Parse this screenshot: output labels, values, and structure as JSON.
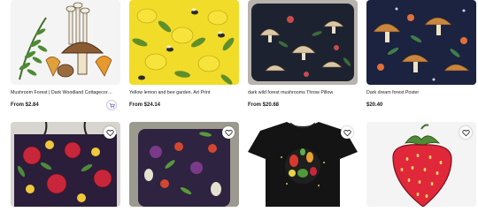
{
  "products": [
    {
      "title": "Mushroom Forest | Dark Woodland Cottagecor…",
      "price": "From $2.84",
      "image_icon": "mushroom-sticker-art",
      "has_cart": true
    },
    {
      "title": "Yellow lemon and bee garden. Art Print",
      "price": "From $24.14",
      "image_icon": "lemon-bee-pattern-art"
    },
    {
      "title": "dark wild forest mushrooms Throw Pillow",
      "price": "From $20.68",
      "image_icon": "mushroom-pillow-art"
    },
    {
      "title": "Dark dream forest Poster",
      "price": "$20.40",
      "image_icon": "mushroom-poster-art"
    },
    {
      "title": "",
      "price": "",
      "image_icon": "pomegranate-tote-bag-art",
      "favorite_icon": "heart-icon"
    },
    {
      "title": "",
      "price": "",
      "image_icon": "vegetable-pillow-art",
      "favorite_icon": "heart-icon"
    },
    {
      "title": "",
      "price": "",
      "image_icon": "vegetable-tshirt-art",
      "favorite_icon": "heart-icon"
    },
    {
      "title": "",
      "price": "",
      "image_icon": "strawberry-sticker-art",
      "favorite_icon": "heart-icon"
    }
  ],
  "colors": {
    "price": "#1a1a1a",
    "cart_border": "#c7c7d8",
    "cart_icon": "#4a4ad0"
  }
}
